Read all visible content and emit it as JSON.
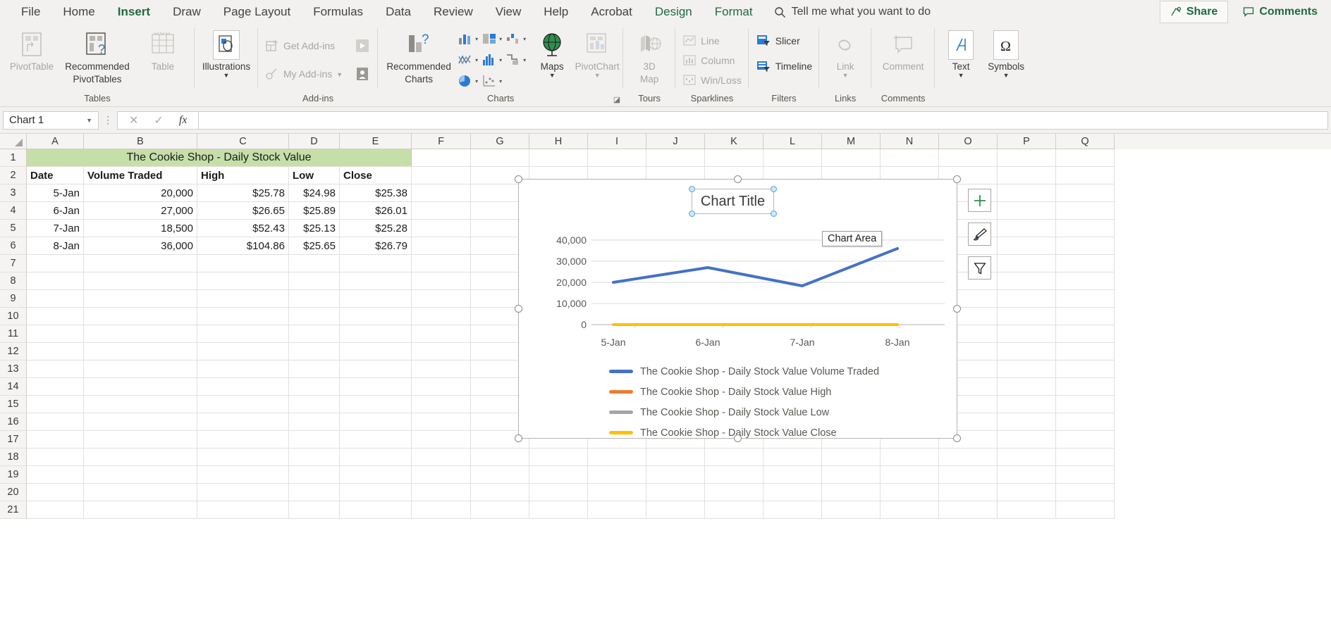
{
  "ribbon": {
    "tabs": [
      {
        "label": "File",
        "state": "normal"
      },
      {
        "label": "Home",
        "state": "normal"
      },
      {
        "label": "Insert",
        "state": "active"
      },
      {
        "label": "Draw",
        "state": "normal"
      },
      {
        "label": "Page Layout",
        "state": "normal"
      },
      {
        "label": "Formulas",
        "state": "normal"
      },
      {
        "label": "Data",
        "state": "normal"
      },
      {
        "label": "Review",
        "state": "normal"
      },
      {
        "label": "View",
        "state": "normal"
      },
      {
        "label": "Help",
        "state": "normal"
      },
      {
        "label": "Acrobat",
        "state": "normal"
      },
      {
        "label": "Design",
        "state": "contextual"
      },
      {
        "label": "Format",
        "state": "contextual"
      }
    ],
    "tell_me": "Tell me what you want to do",
    "share": "Share",
    "comments": "Comments",
    "groups": [
      {
        "name": "Tables",
        "items": [
          "PivotTable",
          "Recommended PivotTables",
          "Table"
        ]
      },
      {
        "name": "",
        "items": [
          "Illustrations"
        ]
      },
      {
        "name": "Add-ins",
        "items": [
          "Get Add-ins",
          "My Add-ins"
        ]
      },
      {
        "name": "Charts",
        "items": [
          "Recommended Charts",
          "Maps",
          "PivotChart"
        ]
      },
      {
        "name": "Tours",
        "items": [
          "3D Map"
        ]
      },
      {
        "name": "Sparklines",
        "items": [
          "Line",
          "Column",
          "Win/Loss"
        ]
      },
      {
        "name": "Filters",
        "items": [
          "Slicer",
          "Timeline"
        ]
      },
      {
        "name": "Links",
        "items": [
          "Link"
        ]
      },
      {
        "name": "Comments",
        "items": [
          "Comment"
        ]
      },
      {
        "name": "",
        "items": [
          "Text",
          "Symbols"
        ]
      }
    ],
    "labels": {
      "pivottable": "PivotTable",
      "recommended_pivottables_l1": "Recommended",
      "recommended_pivottables_l2": "PivotTables",
      "table": "Table",
      "illustrations": "Illustrations",
      "get_addins": "Get Add-ins",
      "my_addins": "My Add-ins",
      "recommended_charts_l1": "Recommended",
      "recommended_charts_l2": "Charts",
      "maps": "Maps",
      "pivotchart": "PivotChart",
      "map3d_l1": "3D",
      "map3d_l2": "Map",
      "sparkline_line": "Line",
      "sparkline_column": "Column",
      "sparkline_winloss": "Win/Loss",
      "slicer": "Slicer",
      "timeline": "Timeline",
      "link": "Link",
      "comment": "Comment",
      "text": "Text",
      "symbols": "Symbols",
      "group_tables": "Tables",
      "group_addins": "Add-ins",
      "group_charts": "Charts",
      "group_tours": "Tours",
      "group_sparklines": "Sparklines",
      "group_filters": "Filters",
      "group_links": "Links",
      "group_comments": "Comments"
    }
  },
  "formula_bar": {
    "name_box_value": "Chart 1",
    "formula_value": "",
    "cancel_icon": "✕",
    "enter_icon": "✓",
    "function_icon": "fx"
  },
  "grid": {
    "columns": [
      "A",
      "B",
      "C",
      "D",
      "E",
      "F",
      "G",
      "H",
      "I",
      "J",
      "K",
      "L",
      "M",
      "N",
      "O",
      "P",
      "Q"
    ],
    "rows": [
      "1",
      "2",
      "3",
      "4",
      "5",
      "6",
      "7",
      "8",
      "9",
      "10",
      "11",
      "12",
      "13",
      "14",
      "15",
      "16",
      "17",
      "18",
      "19",
      "20",
      "21"
    ],
    "merged_title": "The Cookie Shop - Daily Stock Value",
    "headers": [
      "Date",
      "Volume Traded",
      "High",
      "Low",
      "Close"
    ],
    "data": [
      [
        "5-Jan",
        "20,000",
        "$25.78",
        "$24.98",
        "$25.38"
      ],
      [
        "6-Jan",
        "27,000",
        "$26.65",
        "$25.89",
        "$26.01"
      ],
      [
        "7-Jan",
        "18,500",
        "$52.43",
        "$25.13",
        "$25.28"
      ],
      [
        "8-Jan",
        "36,000",
        "$104.86",
        "$25.65",
        "$26.79"
      ]
    ]
  },
  "chart": {
    "title": "Chart Title",
    "tooltip": "Chart Area",
    "side_buttons": [
      "chart-elements-plus",
      "chart-styles-brush",
      "chart-filters-funnel"
    ],
    "colors": {
      "volume": "#4472C4",
      "high": "#ED7D31",
      "low": "#A5A5A5",
      "close": "#FFC000",
      "title_selection": "#5A9BD5",
      "sheet_title_fill": "#C6DFA9"
    }
  },
  "chart_data": {
    "type": "line",
    "title": "Chart Title",
    "xlabel": "",
    "ylabel": "",
    "categories": [
      "5-Jan",
      "6-Jan",
      "7-Jan",
      "8-Jan"
    ],
    "ylim": [
      0,
      40000
    ],
    "yticks": [
      0,
      10000,
      20000,
      30000,
      40000
    ],
    "ytick_labels": [
      "0",
      "10,000",
      "20,000",
      "30,000",
      "40,000"
    ],
    "grid": true,
    "legend_position": "bottom",
    "series": [
      {
        "name": "The Cookie Shop - Daily Stock Value Volume Traded",
        "color": "#4472C4",
        "values": [
          20000,
          27000,
          18500,
          36000
        ]
      },
      {
        "name": "The Cookie Shop - Daily Stock Value High",
        "color": "#ED7D31",
        "values": [
          25.78,
          26.65,
          52.43,
          104.86
        ]
      },
      {
        "name": "The Cookie Shop - Daily Stock Value Low",
        "color": "#A5A5A5",
        "values": [
          24.98,
          25.89,
          25.13,
          25.65
        ]
      },
      {
        "name": "The Cookie Shop - Daily Stock Value Close",
        "color": "#FFC000",
        "values": [
          25.38,
          26.01,
          25.28,
          26.79
        ]
      }
    ]
  }
}
